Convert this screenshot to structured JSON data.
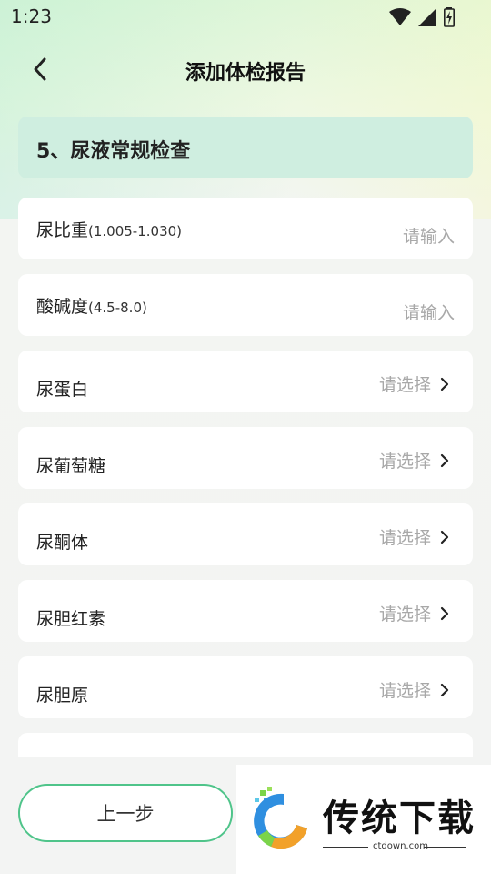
{
  "status": {
    "time": "1:23",
    "icons": [
      "wifi-icon",
      "signal-icon",
      "battery-charging-icon"
    ]
  },
  "header": {
    "title": "添加体检报告",
    "back_icon": "chevron-left-icon"
  },
  "section": {
    "title": "5、尿液常规检查"
  },
  "inputs": [
    {
      "label": "尿比重",
      "range": "(1.005-1.030)",
      "placeholder": "请输入"
    },
    {
      "label": "酸碱度",
      "range": "(4.5-8.0)",
      "placeholder": "请输入"
    }
  ],
  "selects": [
    {
      "label": "尿蛋白",
      "value": "请选择"
    },
    {
      "label": "尿葡萄糖",
      "value": "请选择"
    },
    {
      "label": "尿酮体",
      "value": "请选择"
    },
    {
      "label": "尿胆红素",
      "value": "请选择"
    },
    {
      "label": "尿胆原",
      "value": "请选择"
    }
  ],
  "bottom": {
    "prev_label": "上一步"
  },
  "watermark": {
    "brand": "传统下载",
    "site": "ctdown.com"
  },
  "colors": {
    "accent": "#4fc48a",
    "banner": "#cfeee0",
    "placeholder": "#a8a8a8"
  }
}
